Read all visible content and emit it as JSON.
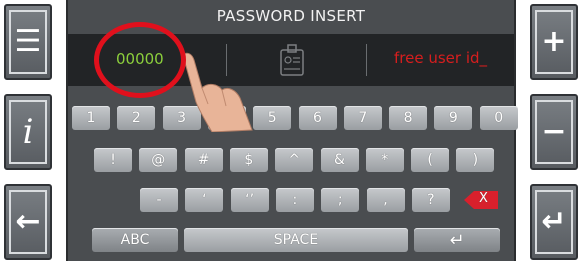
{
  "title": "PASSWORD INSERT",
  "code_value": "00000",
  "user_id_placeholder": "free user id_",
  "side_buttons": {
    "menu": "☰",
    "info": "i",
    "back": "←",
    "plus": "+",
    "minus": "−",
    "enter": "↵"
  },
  "keyboard": {
    "digits": [
      "1",
      "2",
      "3",
      "4",
      "5",
      "6",
      "7",
      "8",
      "9",
      "0"
    ],
    "symbols": [
      "!",
      "@",
      "#",
      "$",
      "^",
      "&",
      "*",
      "(",
      ")"
    ],
    "punct": [
      "-",
      "‘",
      "‘’",
      ":",
      ";",
      ",",
      "?"
    ],
    "abc_label": "ABC",
    "space_label": "SPACE",
    "enter_label": "↵",
    "delete_label": "X"
  },
  "colors": {
    "code": "#8ccf3c",
    "user_id": "#d61e1e",
    "highlight_circle": "#e0101c"
  }
}
